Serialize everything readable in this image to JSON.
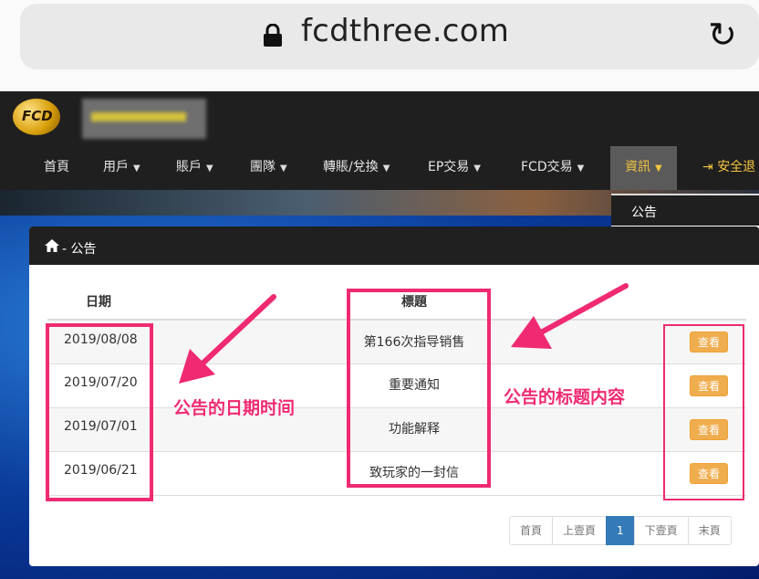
{
  "browser": {
    "url": "fcdthree.com",
    "lock_icon": "lock-icon",
    "reload_icon": "reload-icon"
  },
  "site": {
    "logo_text": "FCD"
  },
  "nav": {
    "items": [
      {
        "label": "首頁",
        "dropdown": false
      },
      {
        "label": "用戶",
        "dropdown": true
      },
      {
        "label": "賬戶",
        "dropdown": true
      },
      {
        "label": "團隊",
        "dropdown": true
      },
      {
        "label": "轉賬/兌換",
        "dropdown": true
      },
      {
        "label": "EP交易",
        "dropdown": true
      },
      {
        "label": "FCD交易",
        "dropdown": true
      },
      {
        "label": "資訊",
        "dropdown": true,
        "active": true
      },
      {
        "label": "安全退",
        "icon": "logout-icon"
      }
    ],
    "dropdown_items": [
      "公告"
    ],
    "active_color": "#f4c542"
  },
  "panel": {
    "breadcrumb": "- 公告",
    "columns": [
      "日期",
      "標題"
    ],
    "rows": [
      {
        "date": "2019/08/08",
        "title": "第166次指导销售",
        "action": "查看"
      },
      {
        "date": "2019/07/20",
        "title": "重要通知",
        "action": "查看"
      },
      {
        "date": "2019/07/01",
        "title": "功能解释",
        "action": "查看"
      },
      {
        "date": "2019/06/21",
        "title": "致玩家的一封信",
        "action": "查看"
      }
    ],
    "pagination": [
      "首頁",
      "上壹頁",
      "1",
      "下壹頁",
      "末頁"
    ],
    "current_page": "1"
  },
  "annotations": {
    "date_label": "公告的日期时间",
    "title_label": "公告的标题内容",
    "color": "#ef2a72"
  }
}
